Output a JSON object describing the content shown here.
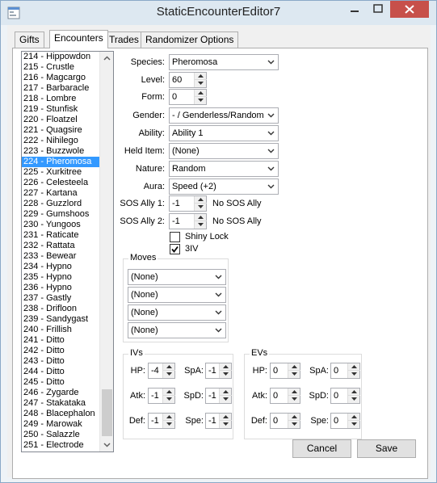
{
  "window": {
    "title": "StaticEncounterEditor7"
  },
  "tabs": [
    {
      "label": "Gifts"
    },
    {
      "label": "Encounters"
    },
    {
      "label": "Trades"
    },
    {
      "label": "Randomizer Options"
    }
  ],
  "encounter_list": {
    "items": [
      "214 - Hippowdon",
      "215 - Crustle",
      "216 - Magcargo",
      "217 - Barbaracle",
      "218 - Lombre",
      "219 - Stunfisk",
      "220 - Floatzel",
      "221 - Quagsire",
      "222 - Nihilego",
      "223 - Buzzwole",
      "224 - Pheromosa",
      "225 - Xurkitree",
      "226 - Celesteela",
      "227 - Kartana",
      "228 - Guzzlord",
      "229 - Gumshoos",
      "230 - Yungoos",
      "231 - Raticate",
      "232 - Rattata",
      "233 - Bewear",
      "234 - Hypno",
      "235 - Hypno",
      "236 - Hypno",
      "237 - Gastly",
      "238 - Drifloon",
      "239 - Sandygast",
      "240 - Frillish",
      "241 - Ditto",
      "242 - Ditto",
      "243 - Ditto",
      "244 - Ditto",
      "245 - Ditto",
      "246 - Zygarde",
      "247 - Stakataka",
      "248 - Blacephalon",
      "249 - Marowak",
      "250 - Salazzle",
      "251 - Electrode"
    ],
    "selected": "224 - Pheromosa"
  },
  "form": {
    "species_label": "Species:",
    "species_value": "Pheromosa",
    "level_label": "Level:",
    "level_value": "60",
    "form_label": "Form:",
    "form_value": "0",
    "gender_label": "Gender:",
    "gender_value": "- / Genderless/Random",
    "ability_label": "Ability:",
    "ability_value": "Ability 1",
    "held_item_label": "Held Item:",
    "held_item_value": "(None)",
    "nature_label": "Nature:",
    "nature_value": "Random",
    "aura_label": "Aura:",
    "aura_value": "Speed (+2)",
    "sos1_label": "SOS Ally 1:",
    "sos1_value": "-1",
    "sos1_note": "No SOS Ally",
    "sos2_label": "SOS Ally 2:",
    "sos2_value": "-1",
    "sos2_note": "No SOS Ally",
    "shiny_lock_label": "Shiny Lock",
    "shiny_lock_checked": false,
    "three_iv_label": "3IV",
    "three_iv_checked": true
  },
  "moves": {
    "title": "Moves",
    "values": [
      "(None)",
      "(None)",
      "(None)",
      "(None)"
    ]
  },
  "ivs": {
    "title": "IVs",
    "hp_label": "HP:",
    "hp": "-4",
    "atk_label": "Atk:",
    "atk": "-1",
    "def_label": "Def:",
    "def": "-1",
    "spa_label": "SpA:",
    "spa": "-1",
    "spd_label": "SpD:",
    "spd": "-1",
    "spe_label": "Spe:",
    "spe": "-1"
  },
  "evs": {
    "title": "EVs",
    "hp_label": "HP:",
    "hp": "0",
    "atk_label": "Atk:",
    "atk": "0",
    "def_label": "Def:",
    "def": "0",
    "spa_label": "SpA:",
    "spa": "0",
    "spd_label": "SpD:",
    "spd": "0",
    "spe_label": "Spe:",
    "spe": "0"
  },
  "buttons": {
    "cancel": "Cancel",
    "save": "Save"
  },
  "colors": {
    "selection": "#3399ff",
    "close_button": "#c7504a"
  }
}
